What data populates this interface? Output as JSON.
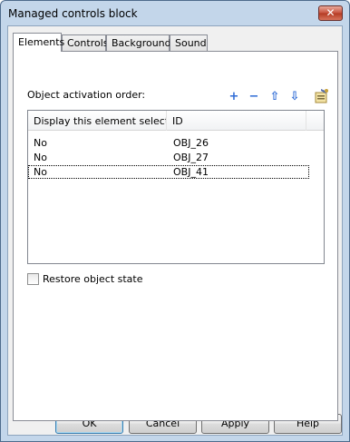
{
  "window": {
    "title": "Managed controls block",
    "close_symbol": "✕"
  },
  "tabs": [
    {
      "label": "Elements",
      "active": true
    },
    {
      "label": "Controls",
      "active": false
    },
    {
      "label": "Background",
      "active": false
    },
    {
      "label": "Sound",
      "active": false
    }
  ],
  "elements": {
    "order_label": "Object activation order:",
    "toolbar": {
      "add": "+",
      "remove": "−",
      "up": "⇧",
      "down": "⇩"
    },
    "list": {
      "columns": [
        "Display this element selecte...",
        "ID"
      ],
      "rows": [
        {
          "display": "No",
          "id": "OBJ_26"
        },
        {
          "display": "No",
          "id": "OBJ_27"
        },
        {
          "display": "No",
          "id": "OBJ_41"
        }
      ]
    },
    "restore_label": "Restore object state",
    "restore_checked": false
  },
  "buttons": {
    "ok": "OK",
    "cancel": "Cancel",
    "apply": "Apply",
    "help": "Help"
  }
}
